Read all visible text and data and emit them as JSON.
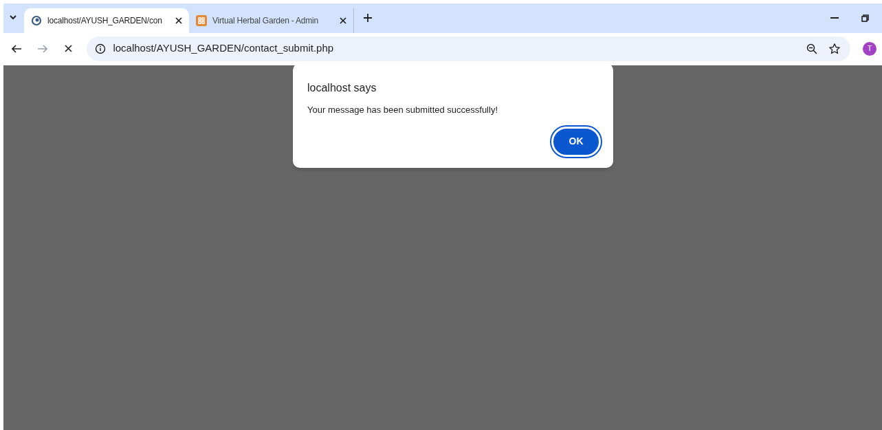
{
  "tabs": [
    {
      "title": "localhost/AYUSH_GARDEN/con",
      "kind": "loading",
      "selected": true
    },
    {
      "title": "Virtual Herbal Garden - Admin",
      "kind": "site",
      "selected": false
    }
  ],
  "address_bar": {
    "url": "localhost/AYUSH_GARDEN/contact_submit.php"
  },
  "profile": {
    "initial": "T"
  },
  "dialog": {
    "title": "localhost says",
    "message": "Your message has been submitted successfully!",
    "button": "OK"
  }
}
